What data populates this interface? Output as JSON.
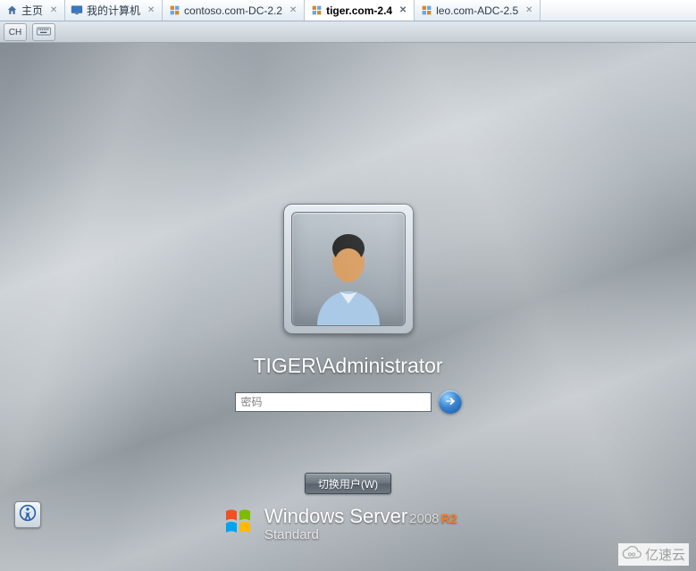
{
  "tabs": [
    {
      "label": "主页",
      "icon": "home"
    },
    {
      "label": "我的计算机",
      "icon": "computer"
    },
    {
      "label": "contoso.com-DC-2.2",
      "icon": "vm"
    },
    {
      "label": "tiger.com-2.4",
      "icon": "vm",
      "active": true
    },
    {
      "label": "leo.com-ADC-2.5",
      "icon": "vm"
    }
  ],
  "toolbar": {
    "btn1": "CH",
    "btn2_icon": "keyboard"
  },
  "login": {
    "username": "TIGER\\Administrator",
    "password_placeholder": "密码",
    "switch_user": "切换用户(W)"
  },
  "branding": {
    "product": "Windows Server",
    "year": "2008",
    "r2": "R2",
    "edition": "Standard"
  },
  "watermark": "亿速云"
}
